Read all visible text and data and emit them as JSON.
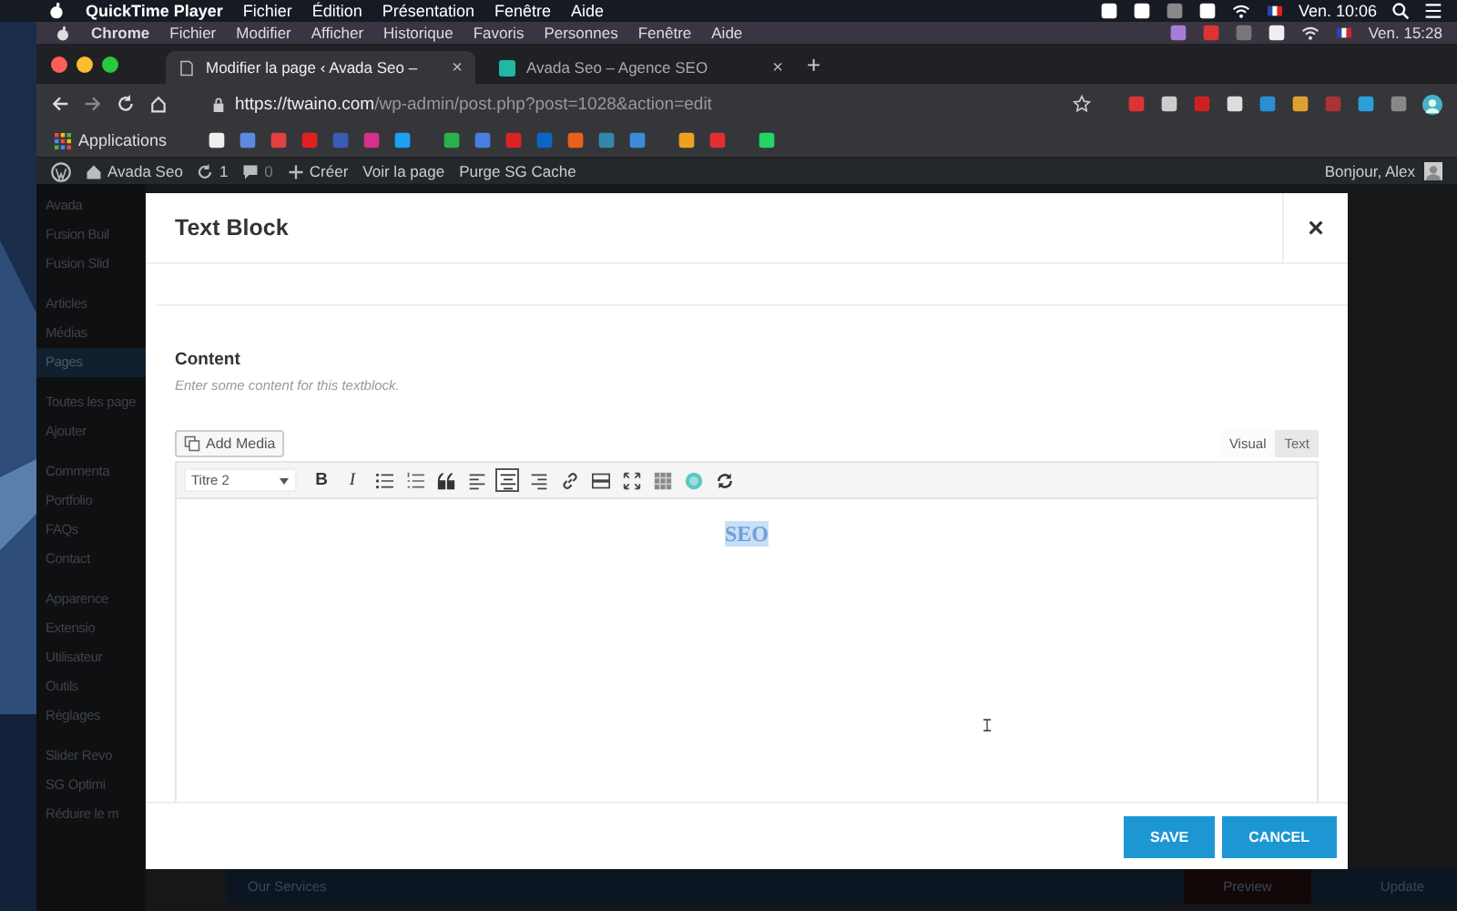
{
  "mac_menu_bar": {
    "app": "QuickTime Player",
    "items": [
      "Fichier",
      "Édition",
      "Présentation",
      "Fenêtre",
      "Aide"
    ],
    "clock": "Ven. 10:06"
  },
  "chrome_menu_bar": {
    "app": "Chrome",
    "items": [
      "Fichier",
      "Modifier",
      "Afficher",
      "Historique",
      "Favoris",
      "Personnes",
      "Fenêtre",
      "Aide"
    ],
    "clock": "Ven. 15:28"
  },
  "browser_tabs": [
    {
      "title": "Modifier la page ‹ Avada Seo –",
      "close": "×",
      "selected": true
    },
    {
      "title": "Avada Seo – Agence SEO",
      "close": "×",
      "selected": false
    }
  ],
  "new_tab": "+",
  "address_bar": {
    "host": "https://twaino.com",
    "path": "/wp-admin/post.php?post=1028&action=edit"
  },
  "bookmarks": {
    "label": "Applications"
  },
  "admin_bar": {
    "site": "Avada Seo",
    "updates": "1",
    "comments": "0",
    "create": "Créer",
    "links": [
      "Voir la page",
      "Purge SG Cache"
    ],
    "greeting": "Bonjour, Alex"
  },
  "sidebar": {
    "items": [
      {
        "label": "Avada",
        "selected": false
      },
      {
        "label": "Fusion Buil",
        "selected": false
      },
      {
        "label": "Fusion Slid",
        "selected": false
      },
      {
        "label": "Articles",
        "selected": false
      },
      {
        "label": "Médias",
        "selected": false
      },
      {
        "label": "Pages",
        "selected": true
      },
      {
        "label": "Toutes les page",
        "selected": false
      },
      {
        "label": "Ajouter",
        "selected": false
      },
      {
        "label": "Commenta",
        "selected": false
      },
      {
        "label": "Portfolio",
        "selected": false
      },
      {
        "label": "FAQs",
        "selected": false
      },
      {
        "label": "Contact",
        "selected": false
      },
      {
        "label": "Apparence",
        "selected": false
      },
      {
        "label": "Extensio",
        "selected": false
      },
      {
        "label": "Utilisateur",
        "selected": false
      },
      {
        "label": "Outils",
        "selected": false
      },
      {
        "label": "Réglages",
        "selected": false
      },
      {
        "label": "Slider Revo",
        "selected": false
      },
      {
        "label": "SG Optimi",
        "selected": false
      },
      {
        "label": "Réduire le m",
        "selected": false
      }
    ]
  },
  "modal": {
    "title": "Text Block",
    "close": "×",
    "content_label": "Content",
    "description": "Enter some content for this textblock.",
    "add_media": "Add Media",
    "editor_tabs": [
      {
        "label": "Visual",
        "selected": true
      },
      {
        "label": "Text",
        "selected": false
      }
    ],
    "format": "Titre 2",
    "toolbar": [
      {
        "kind": "bold",
        "label": "B",
        "selected": false
      },
      {
        "kind": "italic",
        "label": "I",
        "selected": false
      },
      {
        "kind": "bullets",
        "selected": false
      },
      {
        "kind": "numbers",
        "selected": false
      },
      {
        "kind": "quote",
        "selected": false
      },
      {
        "kind": "align-left",
        "selected": false
      },
      {
        "kind": "align-center",
        "selected": true
      },
      {
        "kind": "align-right",
        "selected": false
      },
      {
        "kind": "link",
        "selected": false
      },
      {
        "kind": "hr",
        "selected": false
      },
      {
        "kind": "fullscreen",
        "selected": false
      },
      {
        "kind": "table",
        "selected": false
      },
      {
        "kind": "emoji",
        "selected": false
      },
      {
        "kind": "refresh",
        "selected": false
      }
    ],
    "editor_text": "SEO",
    "buttons": [
      {
        "label": "SAVE"
      },
      {
        "label": "CANCEL"
      }
    ]
  },
  "bottom_bar": {
    "title": "Our Services",
    "preview": "Preview",
    "update": "Update"
  }
}
